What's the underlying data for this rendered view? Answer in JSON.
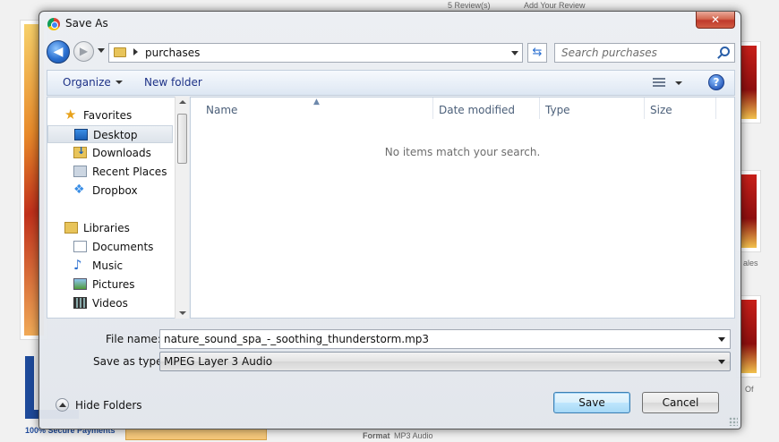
{
  "background": {
    "rating_text": "5 Review(s)",
    "add_review": "Add Your Review",
    "side_text_1": "ales",
    "side_text_2": "Of",
    "format_label": "Format",
    "format_value": "MP3 Audio",
    "bottom_left_text": "100% Secure Payments"
  },
  "dialog": {
    "title": "Save As",
    "close_label": "✕",
    "address": {
      "crumb": "purchases"
    },
    "search": {
      "placeholder": "Search purchases"
    },
    "toolbar": {
      "organize": "Organize",
      "new_folder": "New folder",
      "help": "?"
    },
    "nav": {
      "favorites": "Favorites",
      "desktop": "Desktop",
      "downloads": "Downloads",
      "recent_places": "Recent Places",
      "dropbox": "Dropbox",
      "libraries": "Libraries",
      "documents": "Documents",
      "music": "Music",
      "pictures": "Pictures",
      "videos": "Videos"
    },
    "columns": {
      "name": "Name",
      "date_modified": "Date modified",
      "type": "Type",
      "size": "Size"
    },
    "empty_message": "No items match your search.",
    "file_name_label": "File name:",
    "file_name_value": "nature_sound_spa_-_soothing_thunderstorm.mp3",
    "save_type_label": "Save as type:",
    "save_type_value": "MPEG Layer 3 Audio",
    "hide_folders": "Hide Folders",
    "save_button": "Save",
    "cancel_button": "Cancel"
  }
}
